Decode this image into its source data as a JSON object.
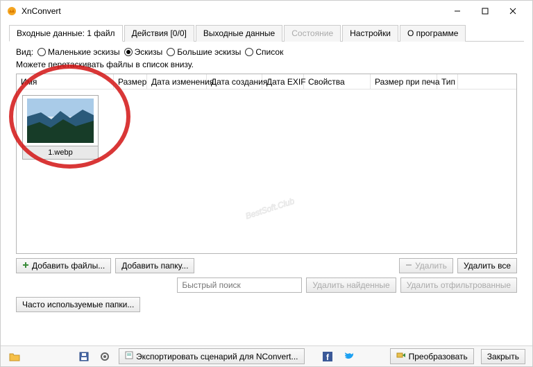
{
  "window": {
    "title": "XnConvert"
  },
  "tabs": {
    "input": "Входные данные: 1 файл",
    "actions": "Действия [0/0]",
    "output": "Выходные данные",
    "status": "Состояние",
    "settings": "Настройки",
    "about": "О программе"
  },
  "view": {
    "label": "Вид:",
    "small_thumbs": "Маленькие эскизы",
    "thumbs": "Эскизы",
    "large_thumbs": "Большие эскизы",
    "list": "Список"
  },
  "hint": "Можете перетаскивать файлы в список внизу.",
  "columns": {
    "name": "Имя",
    "size": "Размер",
    "date_mod": "Дата изменения",
    "date_created": "Дата создания",
    "date_exif": "Дата EXIF",
    "props": "Свойства",
    "print_size": "Размер при печа",
    "type": "Тип"
  },
  "items": [
    {
      "filename": "1.webp"
    }
  ],
  "buttons": {
    "add_files": "Добавить файлы...",
    "add_folder": "Добавить папку...",
    "delete": "Удалить",
    "delete_all": "Удалить все",
    "quick_search_ph": "Быстрый поиск",
    "delete_found": "Удалить найденные",
    "delete_filtered": "Удалить отфильтрованные",
    "freq_folders": "Часто используемые папки...",
    "export_script": "Экспортировать сценарий для NConvert...",
    "convert": "Преобразовать",
    "close": "Закрыть"
  },
  "watermark_text": "BestSoft.Club"
}
